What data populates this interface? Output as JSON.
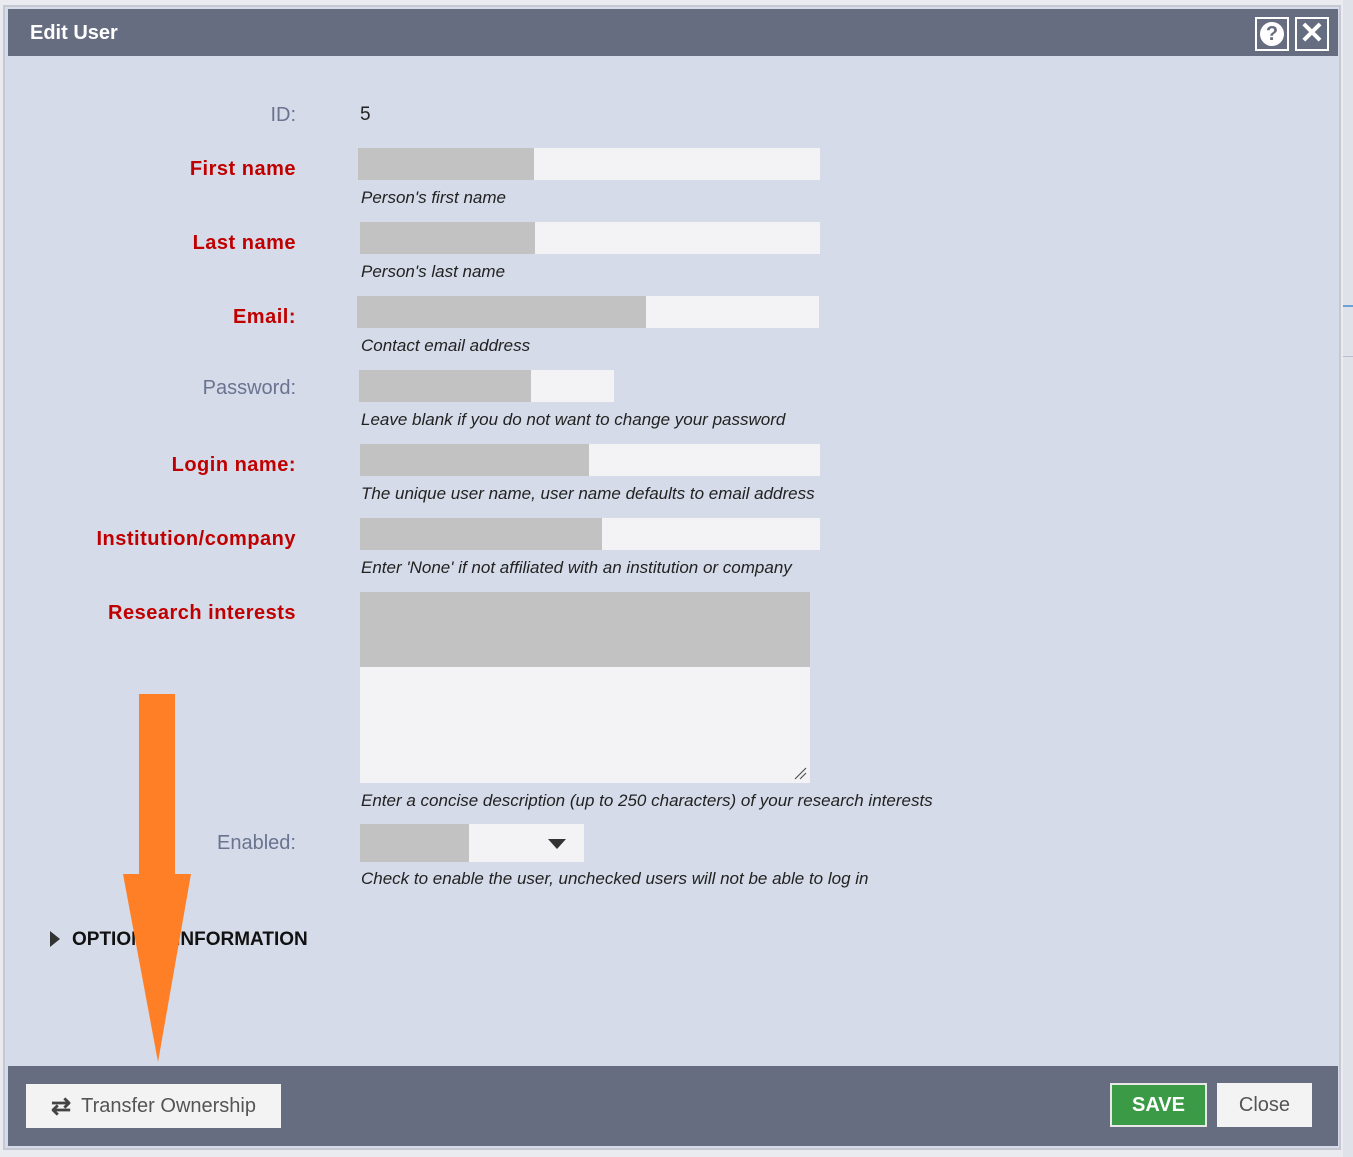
{
  "dialog": {
    "title": "Edit User",
    "help_icon": "help-icon",
    "close_icon": "close-icon"
  },
  "fields": {
    "id": {
      "label": "ID:",
      "value": "5"
    },
    "first_name": {
      "label": "First name",
      "hint": "Person's first name"
    },
    "last_name": {
      "label": "Last name",
      "hint": "Person's last name"
    },
    "email": {
      "label": "Email:",
      "hint": "Contact email address"
    },
    "password": {
      "label": "Password:",
      "hint": "Leave blank if you do not want to change your password"
    },
    "login_name": {
      "label": "Login name:",
      "hint": "The unique user name, user name defaults to email address"
    },
    "institution": {
      "label": "Institution/company",
      "hint": "Enter 'None' if not affiliated with an institution or company"
    },
    "research": {
      "label": "Research interests",
      "hint": "Enter a concise description (up to 250 characters) of your research interests"
    },
    "enabled": {
      "label": "Enabled:",
      "hint": "Check to enable the user, unchecked users will not be able to log in"
    }
  },
  "section": {
    "optional_label": "OPTIONAL INFORMATION"
  },
  "footer": {
    "transfer_label": "Transfer Ownership",
    "save_label": "SAVE",
    "close_label": "Close"
  },
  "colors": {
    "title_bar": "#676d80",
    "panel": "#d5dbe8",
    "required_label": "#c00000",
    "optional_label": "#6a7390",
    "save_button": "#3a9a45",
    "annotation_arrow": "#ff7f27"
  }
}
